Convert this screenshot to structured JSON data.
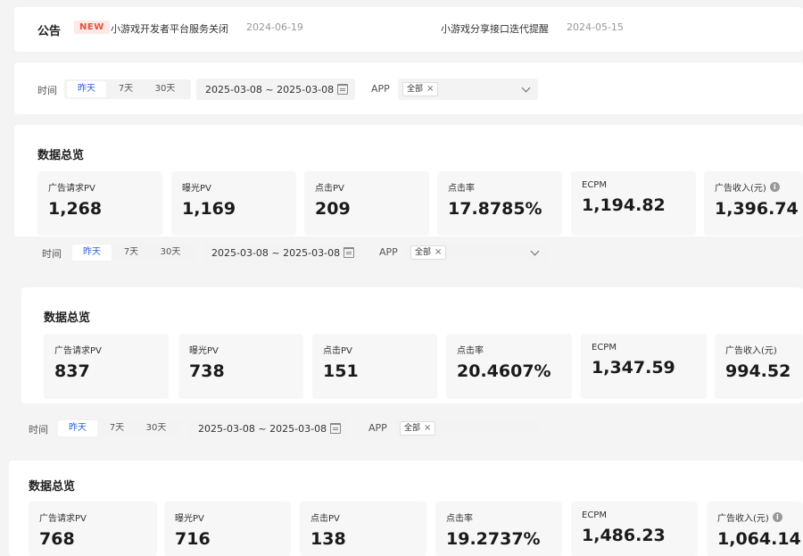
{
  "notice": {
    "title": "公告",
    "badge": "NEW",
    "items": [
      {
        "text": "小游戏开发者平台服务关闭",
        "date": "2024-06-19"
      },
      {
        "text": "小游戏分享接口迭代提醒",
        "date": "2024-05-15"
      }
    ]
  },
  "filters": [
    {
      "time_label": "时间",
      "ranges": [
        "昨天",
        "7天",
        "30天"
      ],
      "active_range": "昨天",
      "date_range": "2025-03-08 ~ 2025-03-08",
      "app_label": "APP",
      "app_tag": "全部"
    },
    {
      "time_label": "时间",
      "ranges": [
        "昨天",
        "7天",
        "30天"
      ],
      "active_range": "昨天",
      "date_range": "2025-03-08 ~ 2025-03-08",
      "app_label": "APP",
      "app_tag": "全部"
    },
    {
      "time_label": "时间",
      "ranges": [
        "昨天",
        "7天",
        "30天"
      ],
      "active_range": "昨天",
      "date_range": "2025-03-08 ~ 2025-03-08",
      "app_label": "APP",
      "app_tag": "全部"
    }
  ],
  "overviews": [
    {
      "title": "数据总览",
      "metrics": [
        {
          "label": "广告请求PV",
          "value": "1,268"
        },
        {
          "label": "曝光PV",
          "value": "1,169"
        },
        {
          "label": "点击PV",
          "value": "209"
        },
        {
          "label": "点击率",
          "value": "17.8785%"
        },
        {
          "label": "ECPM",
          "value": "1,194.82"
        },
        {
          "label": "广告收入(元)",
          "value": "1,396.74"
        }
      ]
    },
    {
      "title": "数据总览",
      "metrics": [
        {
          "label": "广告请求PV",
          "value": "837"
        },
        {
          "label": "曝光PV",
          "value": "738"
        },
        {
          "label": "点击PV",
          "value": "151"
        },
        {
          "label": "点击率",
          "value": "20.4607%"
        },
        {
          "label": "ECPM",
          "value": "1,347.59"
        },
        {
          "label": "广告收入(元)",
          "value": "994.52"
        }
      ]
    },
    {
      "title": "数据总览",
      "metrics": [
        {
          "label": "广告请求PV",
          "value": "768"
        },
        {
          "label": "曝光PV",
          "value": "716"
        },
        {
          "label": "点击PV",
          "value": "138"
        },
        {
          "label": "点击率",
          "value": "19.2737%"
        },
        {
          "label": "ECPM",
          "value": "1,486.23"
        },
        {
          "label": "广告收入(元)",
          "value": "1,064.14"
        }
      ]
    }
  ],
  "colors": {
    "accent": "#2b5fd9",
    "new_badge": "#e8503e",
    "background": "#f4f4f5",
    "card": "#ffffff",
    "metric_bg": "#f7f7f7"
  },
  "icons": {
    "calendar": "calendar-icon",
    "tag_remove": "close-icon",
    "dropdown": "chevron-down-icon",
    "info": "info-icon"
  }
}
